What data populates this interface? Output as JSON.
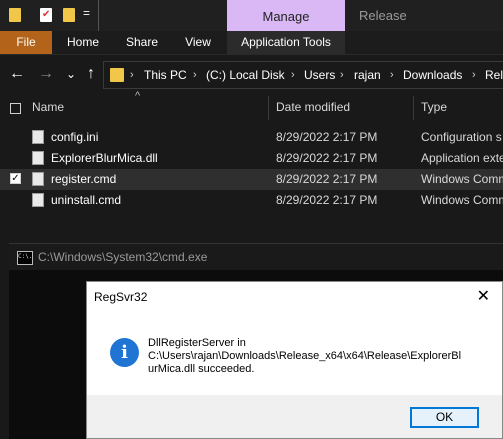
{
  "titlebar": {
    "manage_tab": "Manage",
    "window_title": "Release",
    "qat_dropdown": "="
  },
  "ribbon": {
    "tabs": [
      "File",
      "Home",
      "Share",
      "View",
      "Application Tools"
    ]
  },
  "nav": {
    "back": "←",
    "forward": "→",
    "recent": "⌄",
    "up": "↑",
    "breadcrumbs": [
      "This PC",
      "(C:) Local Disk",
      "Users",
      "rajan",
      "Downloads",
      "Rele"
    ]
  },
  "filelist": {
    "columns": [
      "Name",
      "Date modified",
      "Type"
    ],
    "sort_indicator": "^",
    "rows": [
      {
        "name": "config.ini",
        "date": "8/29/2022 2:17 PM",
        "type": "Configuration s",
        "selected": false
      },
      {
        "name": "ExplorerBlurMica.dll",
        "date": "8/29/2022 2:17 PM",
        "type": "Application exte",
        "selected": false
      },
      {
        "name": "register.cmd",
        "date": "8/29/2022 2:17 PM",
        "type": "Windows Comm",
        "selected": true
      },
      {
        "name": "uninstall.cmd",
        "date": "8/29/2022 2:17 PM",
        "type": "Windows Comm",
        "selected": false
      }
    ]
  },
  "cmd": {
    "title": "C:\\Windows\\System32\\cmd.exe",
    "icon_text": "C:\\."
  },
  "dialog": {
    "title": "RegSvr32",
    "close": "✕",
    "icon": "i",
    "message_line1": "DllRegisterServer in",
    "message_line2": "C:\\Users\\rajan\\Downloads\\Release_x64\\x64\\Release\\ExplorerBl",
    "message_line3": "urMica.dll succeeded.",
    "ok_label": "OK"
  },
  "colors": {
    "file_tab": "#b3631a",
    "manage_tab": "#d9b8f5",
    "ok_border": "#0078d7",
    "info_icon": "#1f74d4"
  }
}
